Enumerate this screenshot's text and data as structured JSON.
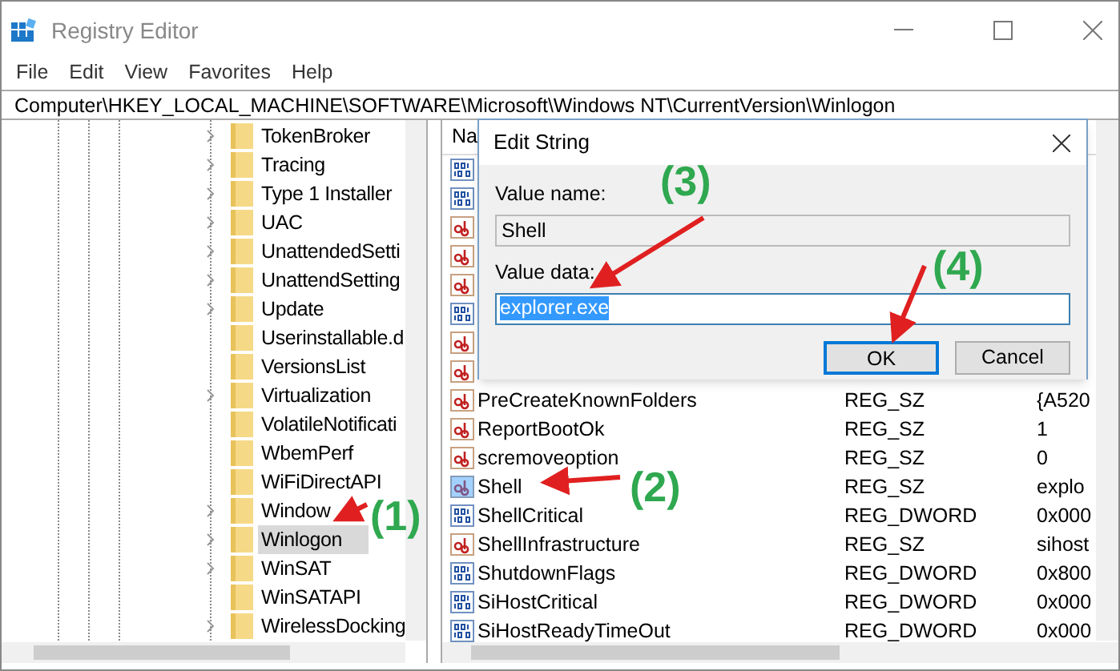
{
  "window": {
    "title": "Registry Editor"
  },
  "menu": [
    "File",
    "Edit",
    "View",
    "Favorites",
    "Help"
  ],
  "address": "Computer\\HKEY_LOCAL_MACHINE\\SOFTWARE\\Microsoft\\Windows NT\\CurrentVersion\\Winlogon",
  "tree": [
    {
      "label": "TokenBroker",
      "expandable": true,
      "selected": false
    },
    {
      "label": "Tracing",
      "expandable": true,
      "selected": false
    },
    {
      "label": "Type 1 Installer",
      "expandable": true,
      "selected": false
    },
    {
      "label": "UAC",
      "expandable": true,
      "selected": false
    },
    {
      "label": "UnattendedSetti",
      "expandable": true,
      "selected": false
    },
    {
      "label": "UnattendSetting",
      "expandable": true,
      "selected": false
    },
    {
      "label": "Update",
      "expandable": true,
      "selected": false
    },
    {
      "label": "Userinstallable.d",
      "expandable": false,
      "selected": false
    },
    {
      "label": "VersionsList",
      "expandable": false,
      "selected": false
    },
    {
      "label": "Virtualization",
      "expandable": true,
      "selected": false
    },
    {
      "label": "VolatileNotificati",
      "expandable": false,
      "selected": false
    },
    {
      "label": "WbemPerf",
      "expandable": false,
      "selected": false
    },
    {
      "label": "WiFiDirectAPI",
      "expandable": false,
      "selected": false
    },
    {
      "label": "Window",
      "expandable": true,
      "selected": false
    },
    {
      "label": "Winlogon",
      "expandable": true,
      "selected": true
    },
    {
      "label": "WinSAT",
      "expandable": true,
      "selected": false
    },
    {
      "label": "WinSATAPI",
      "expandable": false,
      "selected": false
    },
    {
      "label": "WirelessDocking",
      "expandable": true,
      "selected": false
    }
  ],
  "values": {
    "column_1": "Na",
    "rows": [
      {
        "kind": "dword",
        "selected": false
      },
      {
        "kind": "dword",
        "selected": false
      },
      {
        "kind": "sz",
        "selected": false
      },
      {
        "kind": "sz",
        "selected": false
      },
      {
        "kind": "sz",
        "selected": false
      },
      {
        "kind": "dword",
        "selected": false
      },
      {
        "kind": "sz",
        "selected": false
      },
      {
        "kind": "sz",
        "selected": false
      },
      {
        "kind": "sz",
        "name": "PreCreateKnownFolders",
        "type": "REG_SZ",
        "data": "{A520",
        "selected": false
      },
      {
        "kind": "sz",
        "name": "ReportBootOk",
        "type": "REG_SZ",
        "data": "1",
        "selected": false
      },
      {
        "kind": "sz",
        "name": "scremoveoption",
        "type": "REG_SZ",
        "data": "0",
        "selected": false
      },
      {
        "kind": "sz",
        "name": "Shell",
        "type": "REG_SZ",
        "data": "explo",
        "selected": true
      },
      {
        "kind": "dword",
        "name": "ShellCritical",
        "type": "REG_DWORD",
        "data": "0x000",
        "selected": false
      },
      {
        "kind": "sz",
        "name": "ShellInfrastructure",
        "type": "REG_SZ",
        "data": "sihost",
        "selected": false
      },
      {
        "kind": "dword",
        "name": "ShutdownFlags",
        "type": "REG_DWORD",
        "data": "0x800",
        "selected": false
      },
      {
        "kind": "dword",
        "name": "SiHostCritical",
        "type": "REG_DWORD",
        "data": "0x000",
        "selected": false
      },
      {
        "kind": "dword",
        "name": "SiHostReadyTimeOut",
        "type": "REG_DWORD",
        "data": "0x000",
        "selected": false
      }
    ]
  },
  "dialog": {
    "title": "Edit String",
    "value_name_label": "Value name:",
    "value_name": "Shell",
    "value_data_label": "Value data:",
    "value_data": "explorer.exe",
    "buttons": [
      "OK",
      "Cancel"
    ]
  },
  "annotations": [
    "(1)",
    "(2)",
    "(3)",
    "(4)"
  ]
}
